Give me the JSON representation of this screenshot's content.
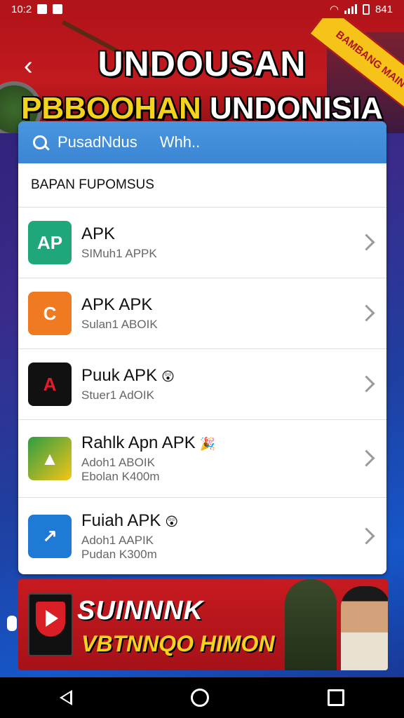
{
  "status_bar": {
    "time": "10:2",
    "right_text": "841"
  },
  "banner": {
    "back_icon": "chevron-left-icon",
    "title_line1": "UNDOUSAN",
    "title_line2_a": "PBBOOHAN",
    "title_line2_b": "UNDONISIA",
    "ribbon": "BAMBANG MAIN"
  },
  "search": {
    "label": "PusadNdus",
    "tab2": "Whh.."
  },
  "section_title": "BAPAN FUPOMSUS",
  "apps": [
    {
      "name": "APK",
      "sub": "SIMuh1 APPK",
      "icon_text": "AP",
      "icon_color": "#1fa67a"
    },
    {
      "name": "APK APK",
      "sub": "Sulan1 ABOIK",
      "icon_text": "C",
      "icon_color": "#f07a22"
    },
    {
      "name": "Puuk APK",
      "sub": "Stuer1 AdOIK",
      "emoji": "😲",
      "icon_text": "A",
      "icon_color": "#111111"
    },
    {
      "name": "Rahlk Apn APK",
      "sub": "Adoh1 ABOIK",
      "sub2": "Ebolan K400m",
      "emoji": "🎉",
      "icon_text": "▲",
      "icon_color": "#2e9d43"
    },
    {
      "name": "Fuiah APK",
      "sub": "Adoh1 AAPIK",
      "sub2": "Pudan K300m",
      "emoji": "😲",
      "icon_text": "↗",
      "icon_color": "#1f7ad6"
    }
  ],
  "ad": {
    "line1": "SUINNNK",
    "line2": "VBTNNQO HIMON"
  },
  "colors": {
    "primary_red": "#b3141a",
    "accent_yellow": "#f5d21c",
    "search_blue": "#3b86d4"
  }
}
